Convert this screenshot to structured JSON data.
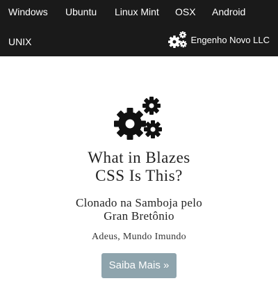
{
  "navbar": {
    "items": [
      {
        "label": "Windows"
      },
      {
        "label": "Ubuntu"
      },
      {
        "label": "Linux Mint"
      },
      {
        "label": "OSX"
      },
      {
        "label": "Android"
      },
      {
        "label": "UNIX"
      }
    ],
    "brand": {
      "label": "Engenho Novo LLC",
      "icon": "gears-icon"
    },
    "background_color": "#1a1a1a",
    "text_color": "#ffffff"
  },
  "hero": {
    "icon": "gears-icon",
    "title_line1": "What in Blazes",
    "title_line2": "CSS Is This?",
    "subtitle_line1": "Clonado na Samboja pelo",
    "subtitle_line2": "Gran Bretônio",
    "tagline": "Adeus, Mundo Imundo",
    "button_label": "Saiba Mais »",
    "button_color": "#8ea4ad"
  }
}
